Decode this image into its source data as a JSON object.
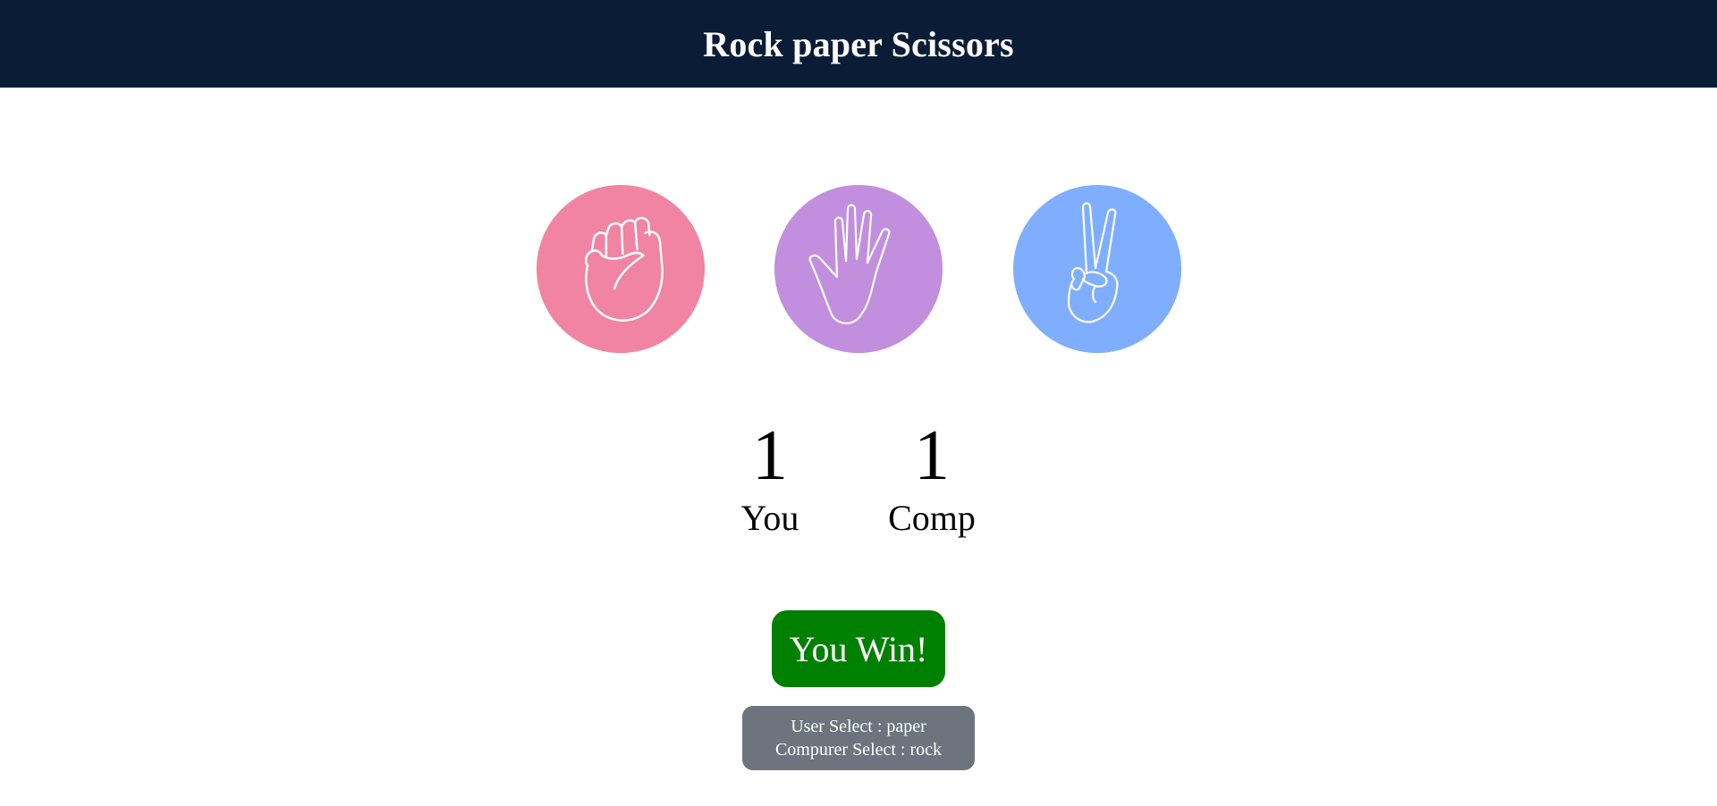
{
  "header": {
    "title": "Rock paper Scissors",
    "background": "#0b1d36"
  },
  "choices": [
    {
      "id": "rock",
      "icon": "fist-icon",
      "color": "#f084a2"
    },
    {
      "id": "paper",
      "icon": "open-hand-icon",
      "color": "#c18fdd"
    },
    {
      "id": "scissors",
      "icon": "peace-hand-icon",
      "color": "#80aeff"
    }
  ],
  "scores": {
    "user": {
      "value": "1",
      "label": "You"
    },
    "comp": {
      "value": "1",
      "label": "Comp"
    }
  },
  "result": {
    "text": "You Win!",
    "color": "#008000"
  },
  "selection": {
    "user_line": "User Select : paper",
    "computer_line": "Compurer Select : rock",
    "background": "#6c757d"
  }
}
